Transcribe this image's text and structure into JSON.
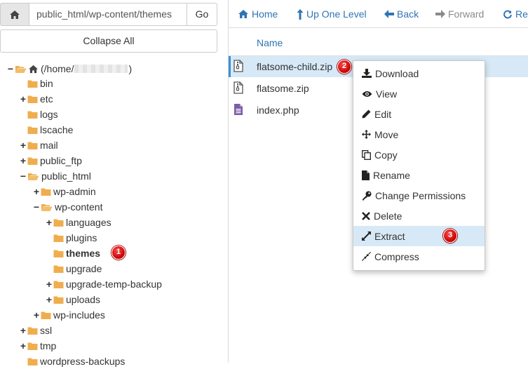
{
  "path_bar": {
    "value": "public_html/wp-content/themes",
    "go_label": "Go"
  },
  "collapse_label": "Collapse All",
  "tree": {
    "root_label_before": "(/home/",
    "root_label_after": ")",
    "items": [
      {
        "label": "bin",
        "toggle": ""
      },
      {
        "label": "etc",
        "toggle": "+"
      },
      {
        "label": "logs",
        "toggle": ""
      },
      {
        "label": "lscache",
        "toggle": ""
      },
      {
        "label": "mail",
        "toggle": "+"
      },
      {
        "label": "public_ftp",
        "toggle": "+"
      },
      {
        "label": "public_html",
        "toggle": "−"
      },
      {
        "label": "wp-admin",
        "toggle": "+"
      },
      {
        "label": "wp-content",
        "toggle": "−"
      },
      {
        "label": "languages",
        "toggle": "+"
      },
      {
        "label": "plugins",
        "toggle": ""
      },
      {
        "label": "themes",
        "toggle": ""
      },
      {
        "label": "upgrade",
        "toggle": ""
      },
      {
        "label": "upgrade-temp-backup",
        "toggle": "+"
      },
      {
        "label": "uploads",
        "toggle": "+"
      },
      {
        "label": "wp-includes",
        "toggle": "+"
      },
      {
        "label": "ssl",
        "toggle": "+"
      },
      {
        "label": "tmp",
        "toggle": "+"
      },
      {
        "label": "wordpress-backups",
        "toggle": ""
      }
    ]
  },
  "toolbar": {
    "home": "Home",
    "up": "Up One Level",
    "back": "Back",
    "forward": "Forward",
    "reload": "Re"
  },
  "table": {
    "name_header": "Name",
    "files": [
      "flatsome-child.zip",
      "flatsome.zip",
      "index.php"
    ]
  },
  "context_menu": {
    "items": [
      "Download",
      "View",
      "Edit",
      "Move",
      "Copy",
      "Rename",
      "Change Permissions",
      "Delete",
      "Extract",
      "Compress"
    ]
  },
  "badges": [
    "1",
    "2",
    "3"
  ],
  "colors": {
    "link": "#2f74b5",
    "folder": "#f0ad4e",
    "selected": "#d7e9f7",
    "badge": "#d40000"
  }
}
